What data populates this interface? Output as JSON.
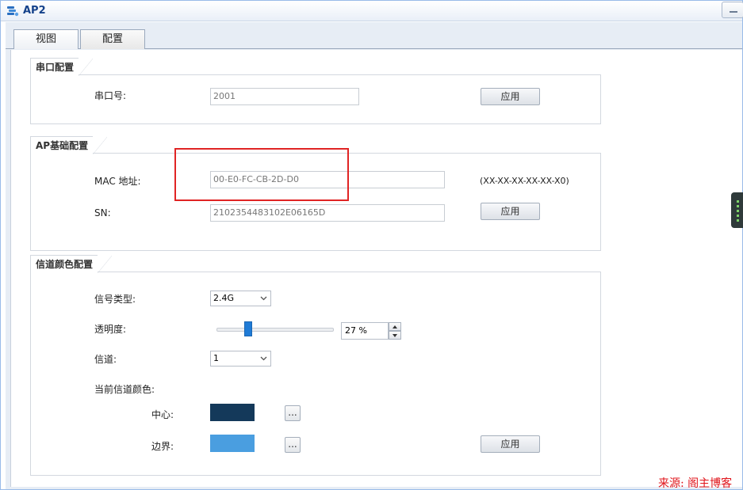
{
  "window": {
    "title": "AP2"
  },
  "tabs": [
    {
      "label": "视图"
    },
    {
      "label": "配置"
    }
  ],
  "serial": {
    "legend": "串口配置",
    "port_label": "串口号:",
    "port_value": "2001",
    "apply_label": "应用"
  },
  "basic": {
    "legend": "AP基础配置",
    "mac_label": "MAC 地址:",
    "mac_value": "00-E0-FC-CB-2D-D0",
    "mac_hint": "(XX-XX-XX-XX-XX-X0)",
    "sn_label": "SN:",
    "sn_value": "2102354483102E06165D",
    "apply_label": "应用"
  },
  "channel": {
    "legend": "信道颜色配置",
    "signal_label": "信号类型:",
    "signal_value": "2.4G",
    "opacity_label": "透明度:",
    "opacity_value": 27,
    "opacity_text": "27 %",
    "channel_label": "信道:",
    "channel_value": "1",
    "current_color_label": "当前信道颜色:",
    "center_label": "中心:",
    "center_color": "#14395a",
    "border_label": "边界:",
    "border_color": "#4a9ee0",
    "picker_label": "...",
    "apply_label": "应用"
  },
  "watermark": "来源: 阁主博客",
  "colors": {
    "highlight": "#e02424",
    "slider_thumb": "#1f7bd6",
    "title": "#15428b"
  },
  "icons": {
    "app": "ap-app-icon",
    "minimize": "minimize-icon",
    "chevron": "chevron-down-icon"
  }
}
